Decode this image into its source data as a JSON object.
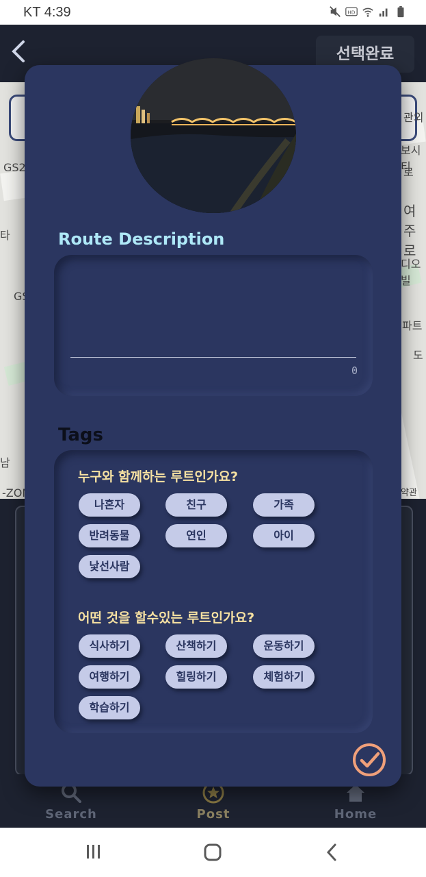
{
  "status_bar": {
    "carrier_time": "KT 4:39"
  },
  "header": {
    "back_icon": "chevron-left-icon",
    "done_label": "선택완료"
  },
  "map": {
    "labels": [
      "GS2",
      "GS",
      "타",
      "남",
      "-ZON",
      "관외",
      "보시티",
      "로",
      "여주로",
      "디오빌",
      "파트",
      "도",
      "약관"
    ]
  },
  "modal": {
    "description": {
      "title": "Route Description",
      "value": "",
      "counter": "0"
    },
    "tags": {
      "title": "Tags",
      "groups": [
        {
          "question": "누구와 함께하는 루트인가요?",
          "chips": [
            "나혼자",
            "친구",
            "가족",
            "반려동물",
            "연인",
            "아이",
            "낯선사람"
          ]
        },
        {
          "question": "어떤 것을 할수있는 루트인가요?",
          "chips": [
            "식사하기",
            "산책하기",
            "운동하기",
            "여행하기",
            "힐링하기",
            "체험하기",
            "학습하기"
          ]
        }
      ]
    },
    "confirm_icon": "check-circle-icon",
    "accent_color": "#f0a07a"
  },
  "bottom_nav": {
    "items": [
      {
        "label": "Search",
        "icon": "search-icon"
      },
      {
        "label": "Post",
        "icon": "star-circle-icon"
      },
      {
        "label": "Home",
        "icon": "home-icon"
      }
    ]
  },
  "system_nav": {
    "icons": [
      "recents-icon",
      "home-circle-icon",
      "back-icon"
    ]
  }
}
